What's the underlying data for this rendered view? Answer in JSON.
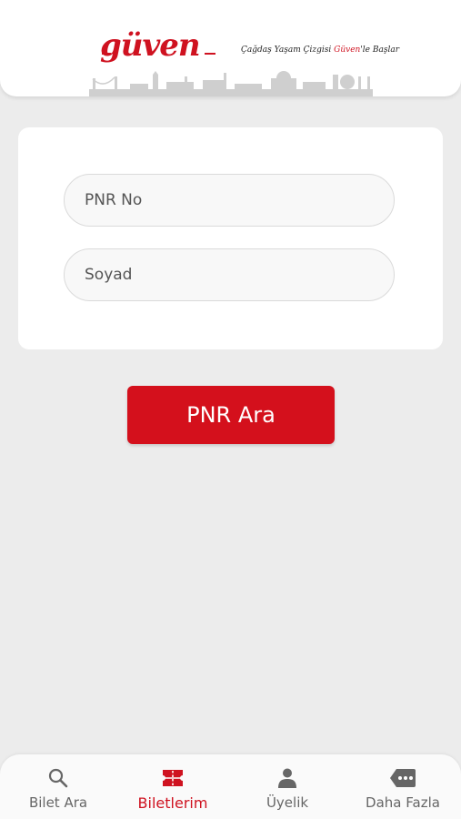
{
  "header": {
    "logo_text": "güven",
    "slogan_part1": "Çağdaş Yaşam Çizgisi ",
    "slogan_brand": "Güven",
    "slogan_part2": "'le Başlar"
  },
  "form": {
    "pnr_placeholder": "PNR No",
    "surname_placeholder": "Soyad",
    "search_label": "PNR Ara"
  },
  "tabs": [
    {
      "label": "Bilet Ara",
      "icon": "search-icon",
      "active": false
    },
    {
      "label": "Biletlerim",
      "icon": "ticket-icon",
      "active": true
    },
    {
      "label": "Üyelik",
      "icon": "user-icon",
      "active": false
    },
    {
      "label": "Daha Fazla",
      "icon": "more-icon",
      "active": false
    }
  ],
  "colors": {
    "brand_red": "#cf1220",
    "background": "#ececec",
    "inactive_tab": "#666666"
  }
}
